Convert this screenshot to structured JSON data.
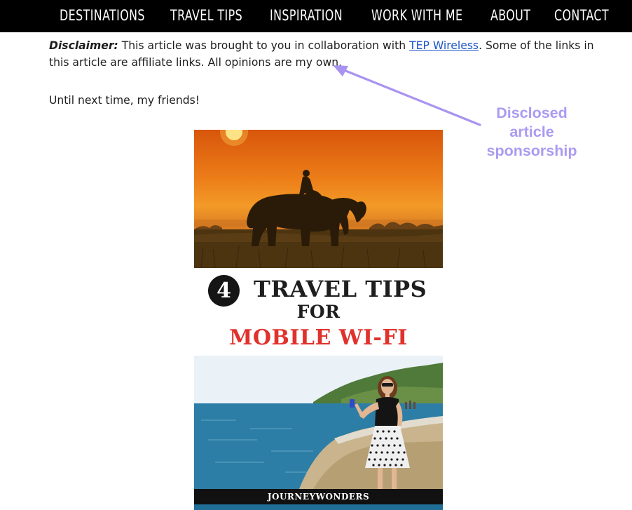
{
  "nav": {
    "items": [
      {
        "label": "DESTINATIONS"
      },
      {
        "label": "TRAVEL TIPS"
      },
      {
        "label": "INSPIRATION"
      },
      {
        "label": "WORK WITH ME"
      },
      {
        "label": "ABOUT"
      },
      {
        "label": "CONTACT"
      }
    ]
  },
  "article": {
    "disclaimer_label": "Disclaimer:",
    "disclaimer_pre": " This article was brought to you in collaboration with ",
    "disclaimer_link": "TEP Wireless",
    "disclaimer_post": ". Some of the links in this article are affiliate links. All opinions are my own.",
    "signoff": "Until next time, my friends!"
  },
  "annotation": {
    "lines": [
      "Disclosed",
      "article",
      "sponsorship"
    ],
    "color": "#ab9bf2"
  },
  "pin": {
    "badge": "4",
    "title": "TRAVEL TIPS",
    "for_text": "FOR",
    "subtitle": "MOBILE WI-FI",
    "brand": "JOURNEYWONDERS",
    "subtitle_color": "#e0322d"
  },
  "colors": {
    "nav_bg": "#000000",
    "link": "#1a55c7"
  }
}
